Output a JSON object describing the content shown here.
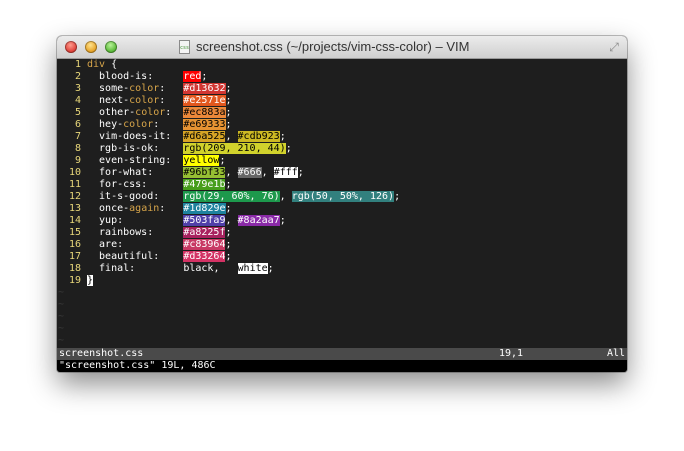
{
  "window": {
    "title": "screenshot.css (~/projects/vim-css-color) – VIM",
    "file_icon_label": "css"
  },
  "lines": [
    {
      "n": "1",
      "segs": [
        {
          "t": "div",
          "c": "#d7a54a"
        },
        {
          "t": " {",
          "c": "#ffffff"
        }
      ]
    },
    {
      "n": "2",
      "segs": [
        {
          "t": "  blood-is:     ",
          "c": "#ffffff"
        },
        {
          "t": "red",
          "bg": "#ff0000",
          "c": "#ffffff"
        },
        {
          "t": ";",
          "c": "#ffffff"
        }
      ]
    },
    {
      "n": "3",
      "segs": [
        {
          "t": "  some-",
          "c": "#ffffff"
        },
        {
          "t": "color",
          "c": "#d7a54a"
        },
        {
          "t": ":   ",
          "c": "#ffffff"
        },
        {
          "t": "#d13632",
          "bg": "#d13632",
          "c": "#ffffff"
        },
        {
          "t": ";",
          "c": "#ffffff"
        }
      ]
    },
    {
      "n": "4",
      "segs": [
        {
          "t": "  next-",
          "c": "#ffffff"
        },
        {
          "t": "color",
          "c": "#d7a54a"
        },
        {
          "t": ":   ",
          "c": "#ffffff"
        },
        {
          "t": "#e2571e",
          "bg": "#e2571e",
          "c": "#ffffff"
        },
        {
          "t": ";",
          "c": "#ffffff"
        }
      ]
    },
    {
      "n": "5",
      "segs": [
        {
          "t": "  other-",
          "c": "#ffffff"
        },
        {
          "t": "color",
          "c": "#d7a54a"
        },
        {
          "t": ":  ",
          "c": "#ffffff"
        },
        {
          "t": "#ec883a",
          "bg": "#ec883a",
          "c": "#000000"
        },
        {
          "t": ";",
          "c": "#ffffff"
        }
      ]
    },
    {
      "n": "6",
      "segs": [
        {
          "t": "  hey-",
          "c": "#ffffff"
        },
        {
          "t": "color",
          "c": "#d7a54a"
        },
        {
          "t": ":    ",
          "c": "#ffffff"
        },
        {
          "t": "#e69333",
          "bg": "#e69333",
          "c": "#000000"
        },
        {
          "t": ";",
          "c": "#ffffff"
        }
      ]
    },
    {
      "n": "7",
      "segs": [
        {
          "t": "  vim-does-it:  ",
          "c": "#ffffff"
        },
        {
          "t": "#d6a525",
          "bg": "#d6a525",
          "c": "#000000"
        },
        {
          "t": ", ",
          "c": "#ffffff"
        },
        {
          "t": "#cdb923",
          "bg": "#cdb923",
          "c": "#000000"
        },
        {
          "t": ";",
          "c": "#ffffff"
        }
      ]
    },
    {
      "n": "8",
      "segs": [
        {
          "t": "  rgb-is-ok:    ",
          "c": "#ffffff"
        },
        {
          "t": "rgb(209, 210, 44)",
          "bg": "#d1d22c",
          "c": "#000000"
        },
        {
          "t": ";",
          "c": "#ffffff"
        }
      ]
    },
    {
      "n": "9",
      "segs": [
        {
          "t": "  even-string:  ",
          "c": "#ffffff"
        },
        {
          "t": "yellow",
          "bg": "#ffff00",
          "c": "#000000"
        },
        {
          "t": ";",
          "c": "#ffffff"
        }
      ]
    },
    {
      "n": "10",
      "segs": [
        {
          "t": "  for-what:     ",
          "c": "#ffffff"
        },
        {
          "t": "#96bf33",
          "bg": "#96bf33",
          "c": "#000000"
        },
        {
          "t": ", ",
          "c": "#ffffff"
        },
        {
          "t": "#666",
          "bg": "#666666",
          "c": "#ffffff"
        },
        {
          "t": ", ",
          "c": "#ffffff"
        },
        {
          "t": "#fff",
          "bg": "#ffffff",
          "c": "#000000"
        },
        {
          "t": ";",
          "c": "#ffffff"
        }
      ]
    },
    {
      "n": "11",
      "segs": [
        {
          "t": "  for-css:      ",
          "c": "#ffffff"
        },
        {
          "t": "#479e1b",
          "bg": "#479e1b",
          "c": "#ffffff"
        },
        {
          "t": ";",
          "c": "#ffffff"
        }
      ]
    },
    {
      "n": "12",
      "segs": [
        {
          "t": "  it-s-good:    ",
          "c": "#ffffff"
        },
        {
          "t": "rgb(29, 60%, 76)",
          "bg": "#1d994c",
          "c": "#ffffff"
        },
        {
          "t": ", ",
          "c": "#ffffff"
        },
        {
          "t": "rgb(50, 50%, 126)",
          "bg": "#32807e",
          "c": "#ffffff"
        },
        {
          "t": ";",
          "c": "#ffffff"
        }
      ]
    },
    {
      "n": "13",
      "segs": [
        {
          "t": "  once-",
          "c": "#ffffff"
        },
        {
          "t": "again",
          "c": "#d7a54a"
        },
        {
          "t": ":   ",
          "c": "#ffffff"
        },
        {
          "t": "#1d829e",
          "bg": "#1d829e",
          "c": "#ffffff"
        },
        {
          "t": ";",
          "c": "#ffffff"
        }
      ]
    },
    {
      "n": "14",
      "segs": [
        {
          "t": "  yup:          ",
          "c": "#ffffff"
        },
        {
          "t": "#503fa9",
          "bg": "#503fa9",
          "c": "#ffffff"
        },
        {
          "t": ", ",
          "c": "#ffffff"
        },
        {
          "t": "#8a2aa7",
          "bg": "#8a2aa7",
          "c": "#ffffff"
        },
        {
          "t": ";",
          "c": "#ffffff"
        }
      ]
    },
    {
      "n": "15",
      "segs": [
        {
          "t": "  rainbows:     ",
          "c": "#ffffff"
        },
        {
          "t": "#a8225f",
          "bg": "#a8225f",
          "c": "#ffffff"
        },
        {
          "t": ";",
          "c": "#ffffff"
        }
      ]
    },
    {
      "n": "16",
      "segs": [
        {
          "t": "  are:          ",
          "c": "#ffffff"
        },
        {
          "t": "#c83964",
          "bg": "#c83964",
          "c": "#ffffff"
        },
        {
          "t": ";",
          "c": "#ffffff"
        }
      ]
    },
    {
      "n": "17",
      "segs": [
        {
          "t": "  beautiful:    ",
          "c": "#ffffff"
        },
        {
          "t": "#d33264",
          "bg": "#d33264",
          "c": "#ffffff"
        },
        {
          "t": ";",
          "c": "#ffffff"
        }
      ]
    },
    {
      "n": "18",
      "segs": [
        {
          "t": "  final:        ",
          "c": "#ffffff"
        },
        {
          "t": "black",
          "c": "#ffffff"
        },
        {
          "t": ",   ",
          "c": "#ffffff"
        },
        {
          "t": "white",
          "bg": "#ffffff",
          "c": "#000000"
        },
        {
          "t": ";",
          "c": "#ffffff"
        }
      ]
    },
    {
      "n": "19",
      "segs": [
        {
          "t": "}",
          "c": "#000000",
          "bg": "#ffffff"
        }
      ]
    }
  ],
  "tilde_char": "~",
  "statusline": {
    "filename": "screenshot.css",
    "position": "19,1",
    "scroll": "All"
  },
  "cmdline": {
    "message": "\"screenshot.css\" 19L, 486C"
  }
}
